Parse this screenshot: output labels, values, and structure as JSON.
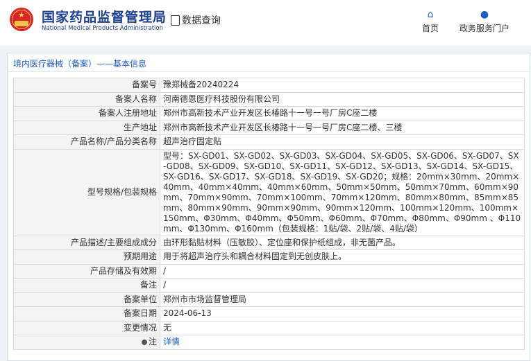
{
  "header": {
    "site_name_cn": "国家药品监督管理局",
    "site_name_en": "National Medical Products Administration",
    "query_label": "数据查询",
    "nav": [
      {
        "label": "首页",
        "icon": "home-icon"
      },
      {
        "label": "政务服务门户",
        "icon": "user-icon"
      }
    ]
  },
  "breadcrumb": "境内医疗器械（备案）——基本信息",
  "fields": [
    {
      "label": "备案号",
      "value": "豫郑械备20240224"
    },
    {
      "label": "备案人名称",
      "value": "河南德恩医疗科技股份有限公司"
    },
    {
      "label": "备案人注册地址",
      "value": "郑州市高新技术产业开发区长椿路十一号一号厂房C座二楼"
    },
    {
      "label": "生产地址",
      "value": "郑州市高新技术产业开发区长椿路十一号一号厂房C座二楼、三楼"
    },
    {
      "label": "产品名称/产品分类名称",
      "value": "超声治疗固定贴"
    },
    {
      "label": "型号规格/包装规格",
      "value": "型号：SX-GD01、SX-GD02、SX-GD03、SX-GD04、SX-GD05、SX-GD06、SX-GD07、SX-GD08、SX-GD09、SX-GD10、SX-GD11、SX-GD12、SX-GD13、SX-GD14、SX-GD15、SX-GD16、SX-GD17、SX-GD18、SX-GD19、SX-GD20；规格：20mm×30mm、20mm×40mm、40mm×40mm、40mm×60mm、50mm×50mm、50mm×70mm、60mm×90mm、70mm×90mm、70mm×100mm、70mm×120mm、80mm×80mm、85mm×85mm、80mm×90mm、90mm×90mm、90mm×120mm、100mm×120mm、100mm×150mm、Φ30mm、Φ40mm、Φ50mm、Φ60mm、Φ70mm、Φ80mm、Φ90mm 、Φ110mm、Φ130mm、Φ160mm（包装规格：1贴/袋、2贴/袋、4贴/袋）"
    },
    {
      "label": "产品描述/主要组成成分",
      "value": "由环形黏贴材料（压敏胶）、定位座和保护纸组成，非无菌产品。"
    },
    {
      "label": "预期用途",
      "value": "用于将超声治疗头和耦合材料固定到无创皮肤上。"
    },
    {
      "label": "产品存储及有效期",
      "value": "/"
    },
    {
      "label": "备注",
      "value": "/"
    },
    {
      "label": "备案单位",
      "value": "郑州市市场监督管理局"
    },
    {
      "label": "备案日期",
      "value": "2024-06-13"
    },
    {
      "label": "变更情况",
      "value": "无"
    }
  ],
  "note": {
    "label": "注",
    "link": "详情",
    "icon": "bulb-icon"
  }
}
